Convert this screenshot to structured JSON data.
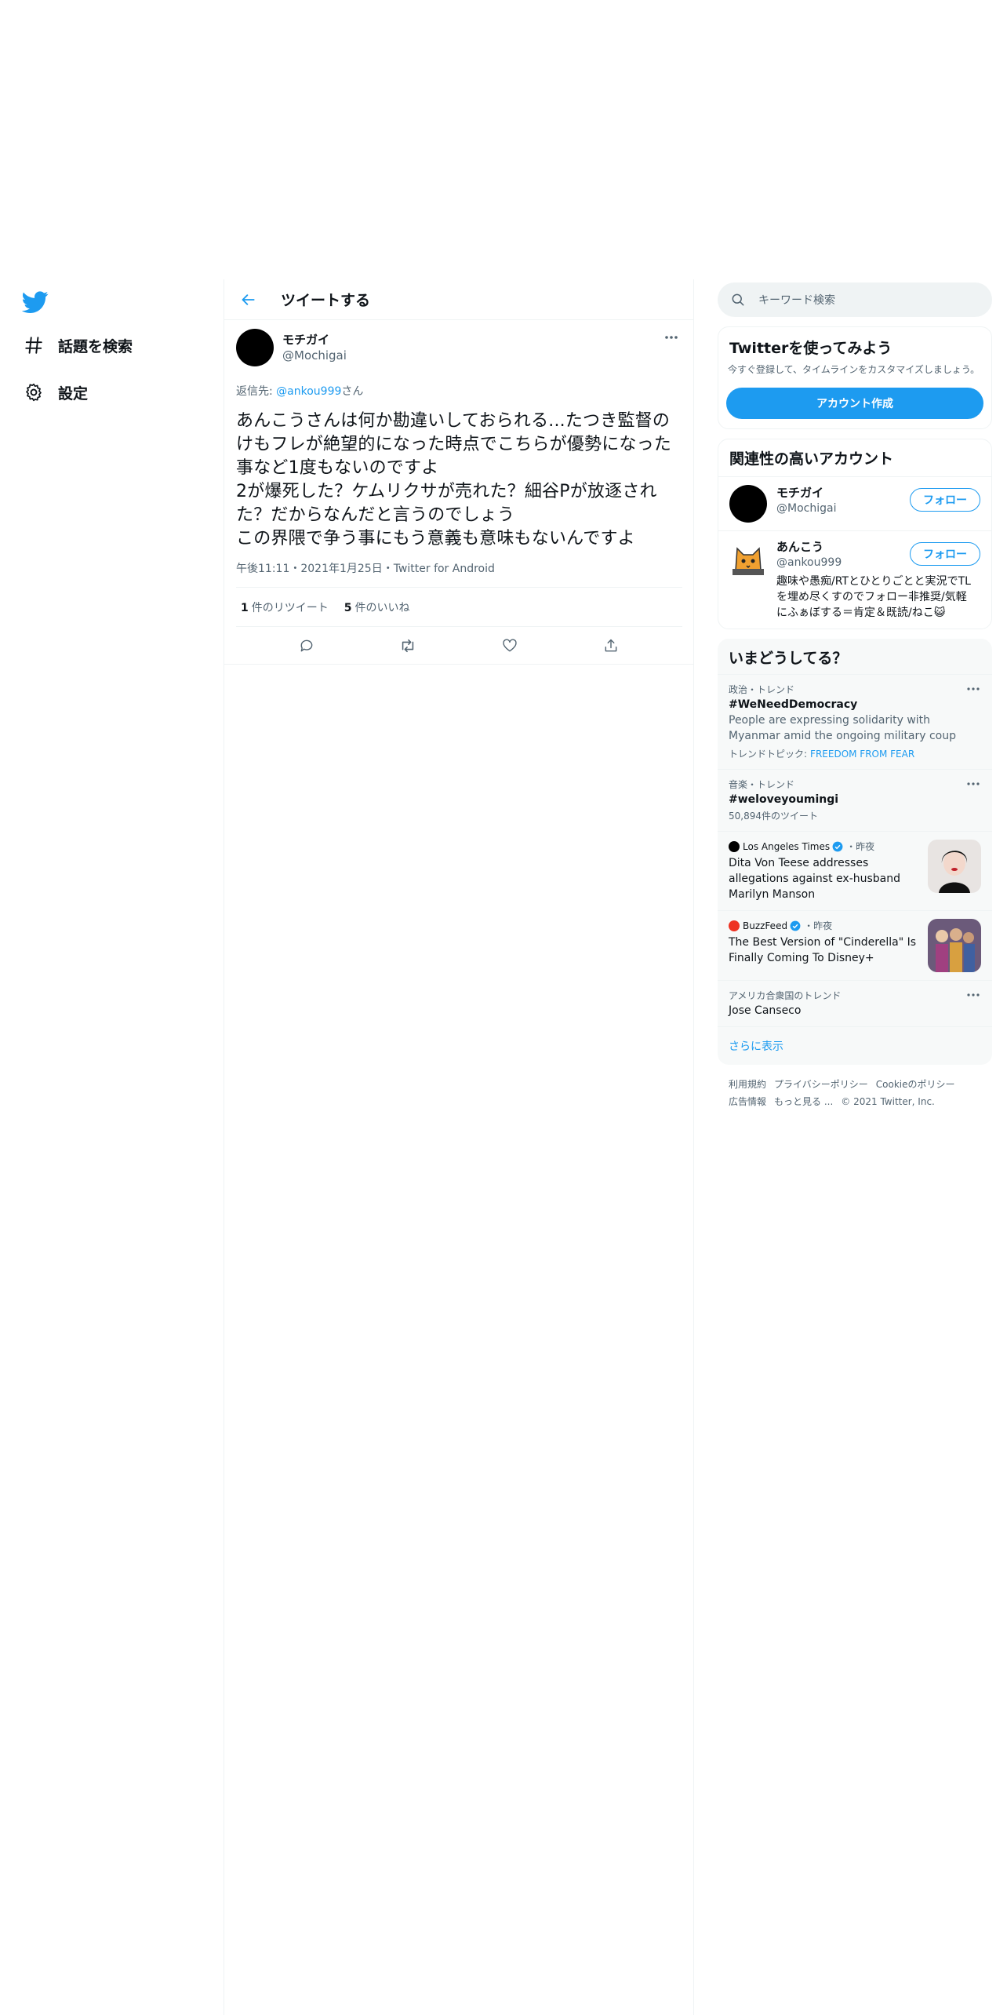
{
  "leftnav": {
    "logo_icon": "twitter-bird-icon",
    "items": [
      {
        "icon": "hashtag-icon",
        "label": "話題を検索"
      },
      {
        "icon": "gear-icon",
        "label": "設定"
      }
    ]
  },
  "header": {
    "title": "ツイートする",
    "back_icon": "arrow-left-icon"
  },
  "tweet": {
    "author_name": "モチガイ",
    "author_handle": "@Mochigai",
    "reply_prefix": "返信先: ",
    "reply_mention": "@ankou999",
    "reply_suffix": "さん",
    "text": "あんこうさんは何か勘違いしておられる...たつき監督のけもフレが絶望的になった時点でこちらが優勢になった事など1度もないのですよ\n2が爆死した？ケムリクサが売れた？細谷Pが放逐された？だからなんだと言うのでしょう\nこの界隈で争う事にもう意義も意味もないんですよ",
    "meta": "午後11:11・2021年1月25日・Twitter for Android",
    "retweet_count": "1",
    "retweet_label": "件のリツイート",
    "like_count": "5",
    "like_label": "件のいいね"
  },
  "search": {
    "placeholder": "キーワード検索"
  },
  "signup": {
    "title": "Twitterを使ってみよう",
    "desc": "今すぐ登録して、タイムラインをカスタマイズしましょう。",
    "button": "アカウント作成"
  },
  "related": {
    "title": "関連性の高いアカウント",
    "accounts": [
      {
        "name": "モチガイ",
        "handle": "@Mochigai",
        "bio": "",
        "follow": "フォロー"
      },
      {
        "name": "あんこう",
        "handle": "@ankou999",
        "bio": "趣味や愚痴/RTとひとりごとと実況でTLを埋め尽くすのでフォロー非推奨/気軽にふぁぼする＝肯定＆既読/ねこ😺",
        "follow": "フォロー"
      }
    ]
  },
  "trends": {
    "title": "いまどうしてる？",
    "items": [
      {
        "category": "政治・トレンド",
        "name": "#WeNeedDemocracy",
        "desc": "People are expressing solidarity with Myanmar amid the ongoing military coup",
        "topic_label": "トレンドトピック:",
        "topic": "FREEDOM FROM FEAR"
      },
      {
        "category": "音楽・トレンド",
        "name": "#weloveyoumingi",
        "count": "50,894件のツイート"
      },
      {
        "category": "アメリカ合衆国のトレンド",
        "name": "Jose Canseco"
      }
    ],
    "news": [
      {
        "source": "Los Angeles Times",
        "time": "・昨夜",
        "title": "Dita Von Teese addresses allegations against ex-husband Marilyn Manson",
        "logo_color": "#000000"
      },
      {
        "source": "BuzzFeed",
        "time": "・昨夜",
        "title": "The Best Version of \"Cinderella\" Is Finally Coming To Disney+",
        "logo_color": "#ee3322"
      }
    ],
    "show_more": "さらに表示"
  },
  "footer": {
    "links": [
      "利用規約",
      "プライバシーポリシー",
      "Cookieのポリシー",
      "広告情報",
      "もっと見る ...",
      "© 2021 Twitter, Inc."
    ]
  },
  "colors": {
    "accent": "#1d9bf0",
    "text": "#0f1419",
    "muted": "#536471"
  }
}
